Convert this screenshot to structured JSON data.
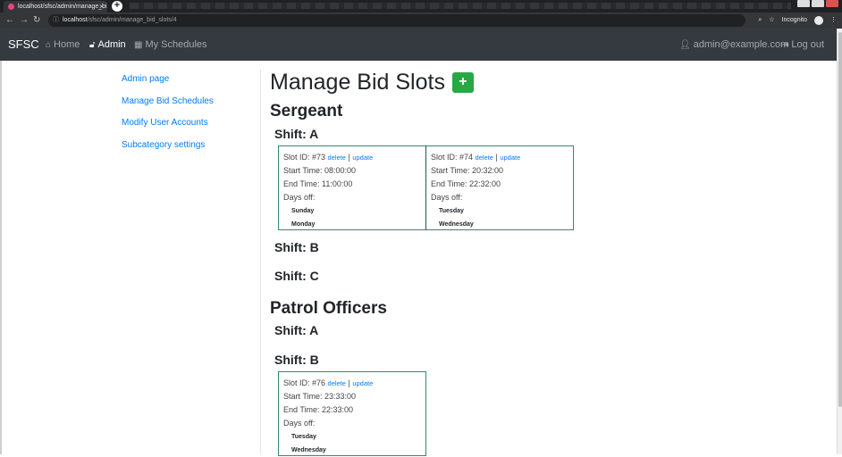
{
  "browser": {
    "tab_title": "localhost/sfsc/admin/manage_bi",
    "url_host": "localhost",
    "url_path": "/sfsc/admin/manage_bid_slots/4",
    "incognito_label": "Incognito"
  },
  "navbar": {
    "brand": "SFSC",
    "home": "Home",
    "admin": "Admin",
    "my_schedules": "My Schedules",
    "user": "admin@example.com",
    "logout": "Log out"
  },
  "sidebar": {
    "items": [
      {
        "label": "Admin page"
      },
      {
        "label": "Manage Bid Schedules"
      },
      {
        "label": "Modify User Accounts"
      },
      {
        "label": "Subcategory settings"
      }
    ]
  },
  "main": {
    "title": "Manage Bid Slots",
    "add_label": "+",
    "groups": [
      {
        "name": "Sergeant",
        "shifts": [
          {
            "label": "Shift: A",
            "slots": [
              {
                "id": "Slot ID: #73",
                "delete": "delete",
                "update": "update",
                "start": "Start Time: 08:00:00",
                "end": "End Time: 11:00:00",
                "days_label": "Days off:",
                "days": [
                  "Sunday",
                  "Monday"
                ]
              },
              {
                "id": "Slot ID: #74",
                "delete": "delete",
                "update": "update",
                "start": "Start Time: 20:32:00",
                "end": "End Time: 22:32:00",
                "days_label": "Days off:",
                "days": [
                  "Tuesday",
                  "Wednesday"
                ]
              }
            ]
          },
          {
            "label": "Shift: B",
            "slots": []
          },
          {
            "label": "Shift: C",
            "slots": []
          }
        ]
      },
      {
        "name": "Patrol Officers",
        "shifts": [
          {
            "label": "Shift: A",
            "slots": []
          },
          {
            "label": "Shift: B",
            "slots": [
              {
                "id": "Slot ID: #76",
                "delete": "delete",
                "update": "update",
                "start": "Start Time: 23:33:00",
                "end": "End Time: 22:33:00",
                "days_label": "Days off:",
                "days": [
                  "Tuesday",
                  "Wednesday"
                ]
              }
            ]
          }
        ]
      }
    ]
  }
}
